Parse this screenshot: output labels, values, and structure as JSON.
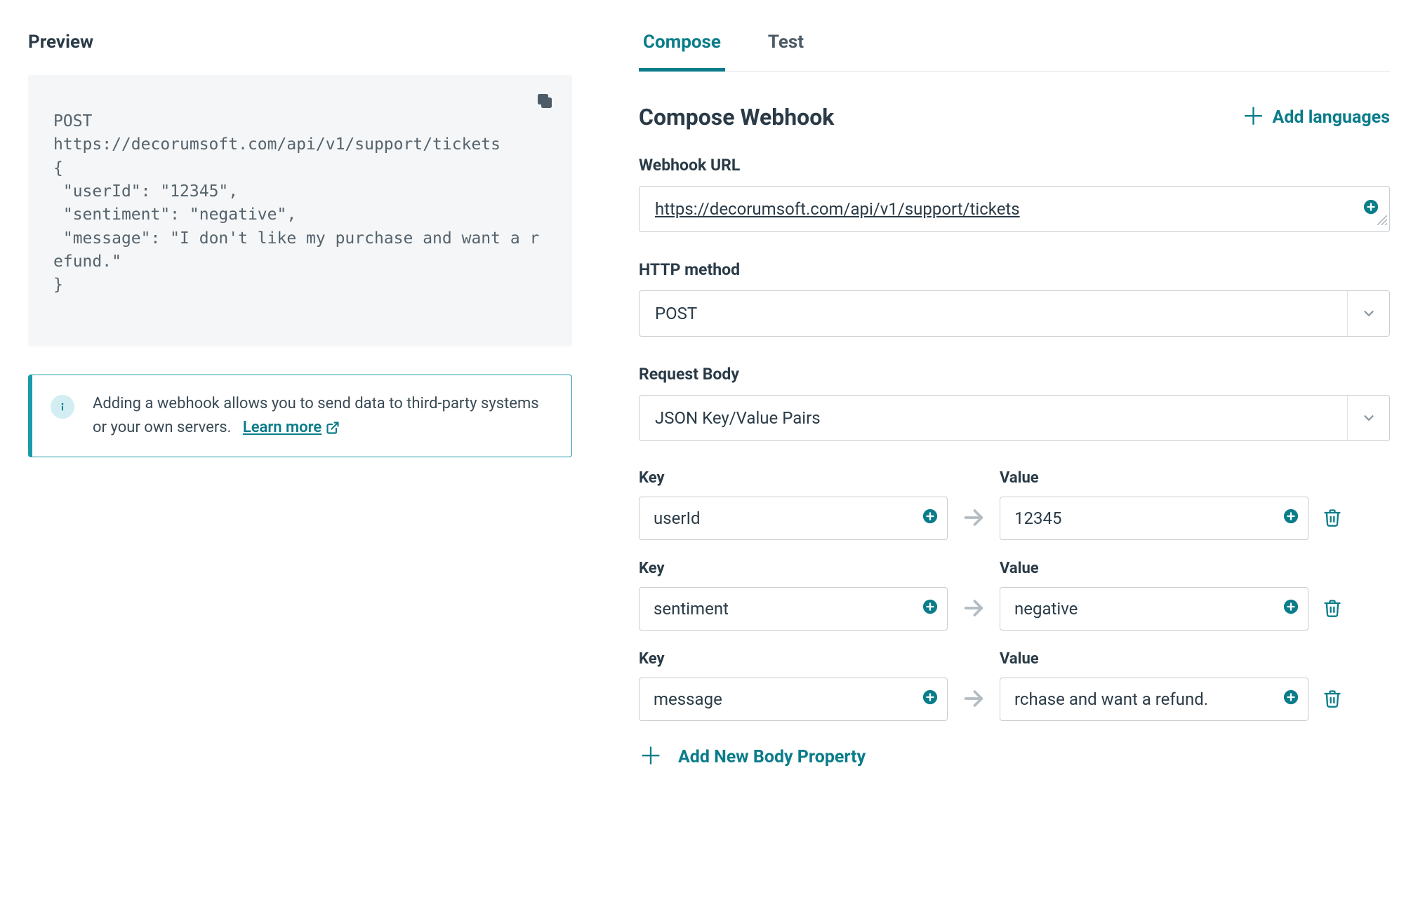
{
  "preview": {
    "title": "Preview",
    "code": "POST\nhttps://decorumsoft.com/api/v1/support/tickets\n{\n \"userId\": \"12345\",\n \"sentiment\": \"negative\",\n \"message\": \"I don't like my purchase and want a refund.\"\n}",
    "info_text": "Adding a webhook allows you to send data to third-party systems or your own servers.",
    "info_link": "Learn more"
  },
  "tabs": {
    "compose": "Compose",
    "test": "Test"
  },
  "compose": {
    "title": "Compose Webhook",
    "add_languages": "Add languages",
    "url_label": "Webhook URL",
    "url_value": "https://decorumsoft.com/api/v1/support/tickets",
    "method_label": "HTTP method",
    "method_value": "POST",
    "body_label": "Request Body",
    "body_value": "JSON Key/Value Pairs",
    "key_label": "Key",
    "value_label": "Value",
    "pairs": [
      {
        "key": "userId",
        "value": "12345",
        "value_display": "12345"
      },
      {
        "key": "sentiment",
        "value": "negative",
        "value_display": "negative"
      },
      {
        "key": "message",
        "value": "I don't like my purchase and want a refund.",
        "value_display": "rchase and want a refund."
      }
    ],
    "add_body": "Add New Body Property"
  },
  "icons": {
    "copy": "copy-icon",
    "info": "info-icon",
    "external": "external-link-icon",
    "plus_circle": "plus-circle-icon",
    "chevron_down": "chevron-down-icon",
    "arrow_right": "arrow-right-icon",
    "trash": "trash-icon",
    "plus": "plus-icon"
  },
  "colors": {
    "accent": "#0a7c8a",
    "text": "#2a3b47",
    "muted": "#4d5b66",
    "border": "#c7cdd2",
    "code_bg": "#f5f6f7"
  }
}
